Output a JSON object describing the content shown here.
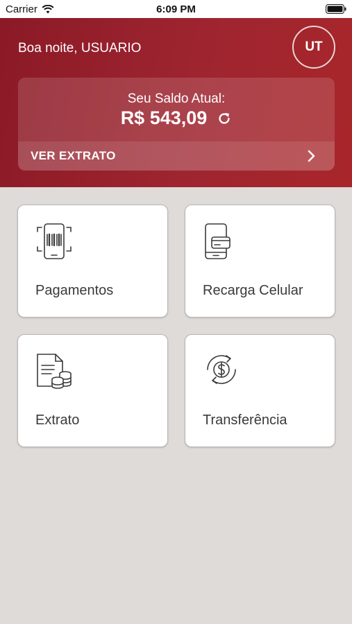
{
  "status_bar": {
    "carrier": "Carrier",
    "time": "6:09 PM"
  },
  "header": {
    "greeting": "Boa noite, USUARIO",
    "avatar_initials": "UT"
  },
  "balance": {
    "label": "Seu Saldo Atual:",
    "value": "R$ 543,09",
    "statement_link": "VER EXTRATO"
  },
  "tiles": [
    {
      "label": "Pagamentos",
      "icon": "barcode-phone-icon"
    },
    {
      "label": "Recarga Celular",
      "icon": "phone-card-icon"
    },
    {
      "label": "Extrato",
      "icon": "document-coins-icon"
    },
    {
      "label": "Transferência",
      "icon": "money-transfer-icon"
    }
  ],
  "colors": {
    "header_bg": "#9e2530",
    "page_bg": "#dedbd8",
    "tile_bg": "#ffffff",
    "icon_stroke": "#3a3a3a"
  }
}
